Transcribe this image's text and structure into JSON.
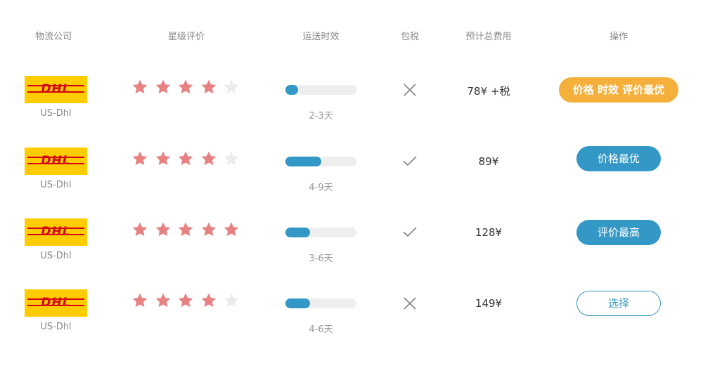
{
  "headers": {
    "company": "物流公司",
    "rating": "星级评价",
    "delivery": "运送时效",
    "tax_included": "包税",
    "total_cost": "预计总费用",
    "action": "操作"
  },
  "colors": {
    "star_on": "#e88282",
    "star_off": "#ececec",
    "bar_fill": "#3498c6",
    "bar_track": "#eeeeee",
    "button_primary": "#3498c6",
    "button_best": "#f5b03b",
    "dhl_yellow": "#ffcc00",
    "dhl_red": "#d40511"
  },
  "rows": [
    {
      "logo_text": "DHL",
      "company": "US-Dhl",
      "rating": 4,
      "delivery_fraction": 0.18,
      "delivery": "2-3天",
      "tax": "cross-icon",
      "price": "78¥ +税",
      "action": "价格 时效 评价最优",
      "action_style": "orange"
    },
    {
      "logo_text": "DHL",
      "company": "US-Dhl",
      "rating": 4,
      "delivery_fraction": 0.5,
      "delivery": "4-9天",
      "tax": "check-icon",
      "price": "89¥",
      "action": "价格最优",
      "action_style": "blue"
    },
    {
      "logo_text": "DHL",
      "company": "US-Dhl",
      "rating": 5,
      "delivery_fraction": 0.35,
      "delivery": "3-6天",
      "tax": "check-icon",
      "price": "128¥",
      "action": "评价最高",
      "action_style": "blue"
    },
    {
      "logo_text": "DHL",
      "company": "US-Dhl",
      "rating": 4,
      "delivery_fraction": 0.35,
      "delivery": "4-6天",
      "tax": "cross-icon",
      "price": "149¥",
      "action": "选择",
      "action_style": "outline"
    }
  ]
}
